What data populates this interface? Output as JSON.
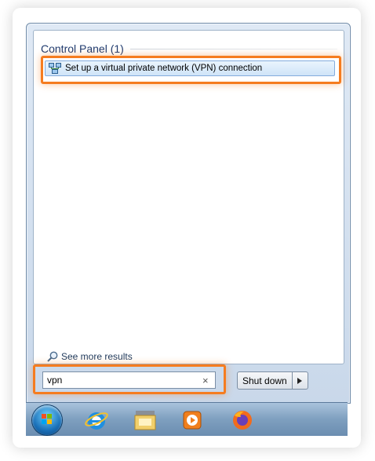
{
  "results": {
    "group_label": "Control Panel (1)",
    "items": [
      {
        "label": "Set up a virtual private network (VPN) connection",
        "icon": "network-icon"
      }
    ],
    "see_more_label": "See more results"
  },
  "search": {
    "value": "vpn",
    "clear_icon": "×"
  },
  "power": {
    "shutdown_label": "Shut down",
    "arrow_icon": "▸"
  },
  "taskbar": {
    "items": [
      "start-orb",
      "internet-explorer-icon",
      "file-explorer-icon",
      "media-player-icon",
      "firefox-icon"
    ]
  },
  "colors": {
    "highlight": "#f57c1f",
    "selected_item_bg": "#cfe4f8",
    "header_text": "#1e3a6e"
  }
}
